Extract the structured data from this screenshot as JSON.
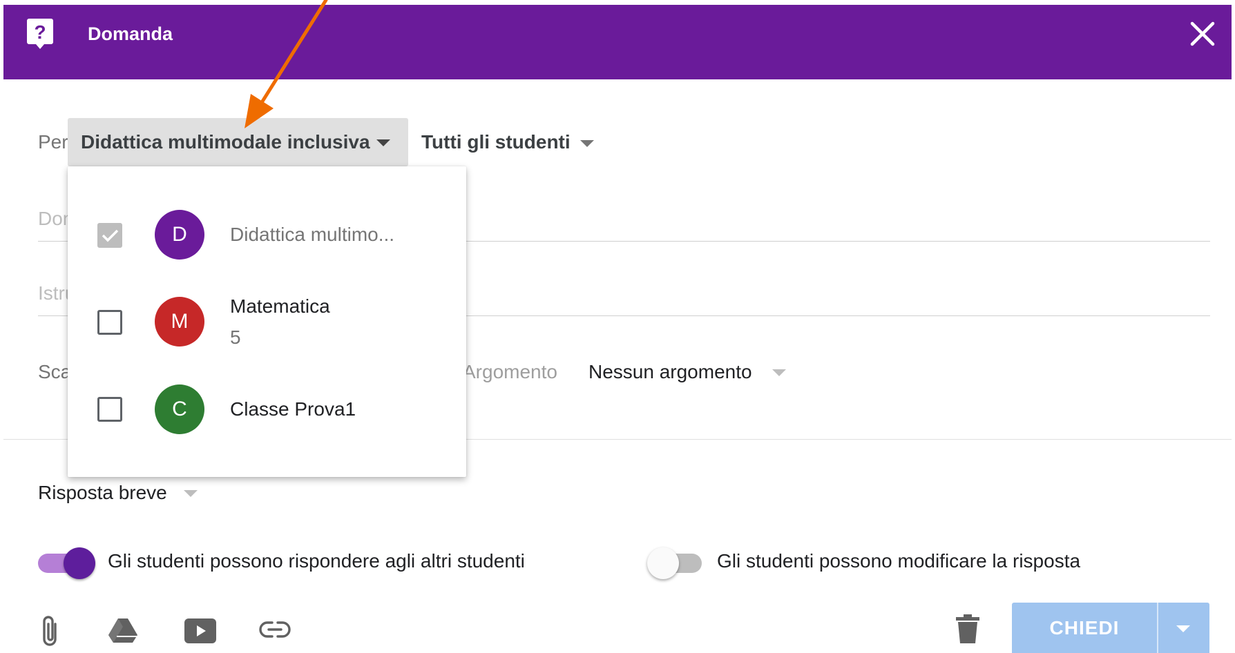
{
  "header": {
    "title": "Domanda",
    "background": "#6a1b9a",
    "help_icon": "help-bubble-icon",
    "close_icon": "close-icon"
  },
  "assign": {
    "per_label": "Per",
    "class_value": "Didattica multimodale inclusiva",
    "students_value": "Tutti gli studenti"
  },
  "form": {
    "question_placeholder": "Domanda",
    "instructions_placeholder": "Istruzioni (facoltative)",
    "due_label": "Scadenza",
    "topic_label": "Argomento",
    "topic_value": "Nessun argomento",
    "answer_type": "Risposta breve"
  },
  "toggles": [
    {
      "label": "Gli studenti possono rispondere agli altri studenti",
      "on": true
    },
    {
      "label": "Gli studenti possono modificare la risposta",
      "on": false
    }
  ],
  "toolbar": {
    "icons": [
      "attach-icon",
      "drive-icon",
      "youtube-icon",
      "link-icon",
      "delete-icon"
    ],
    "submit_label": "CHIEDI",
    "submit_color": "#9fc4ef"
  },
  "class_menu": {
    "items": [
      {
        "initial": "D",
        "name": "Didattica multimo...",
        "subtitle": "",
        "checked": true,
        "color": "#6a1b9a"
      },
      {
        "initial": "M",
        "name": "Matematica",
        "subtitle": "5",
        "checked": false,
        "color": "#c62828"
      },
      {
        "initial": "C",
        "name": "Classe Prova1",
        "subtitle": "",
        "checked": false,
        "color": "#2e7d32"
      }
    ]
  },
  "annotation": {
    "arrow_color": "#ef6c00"
  }
}
